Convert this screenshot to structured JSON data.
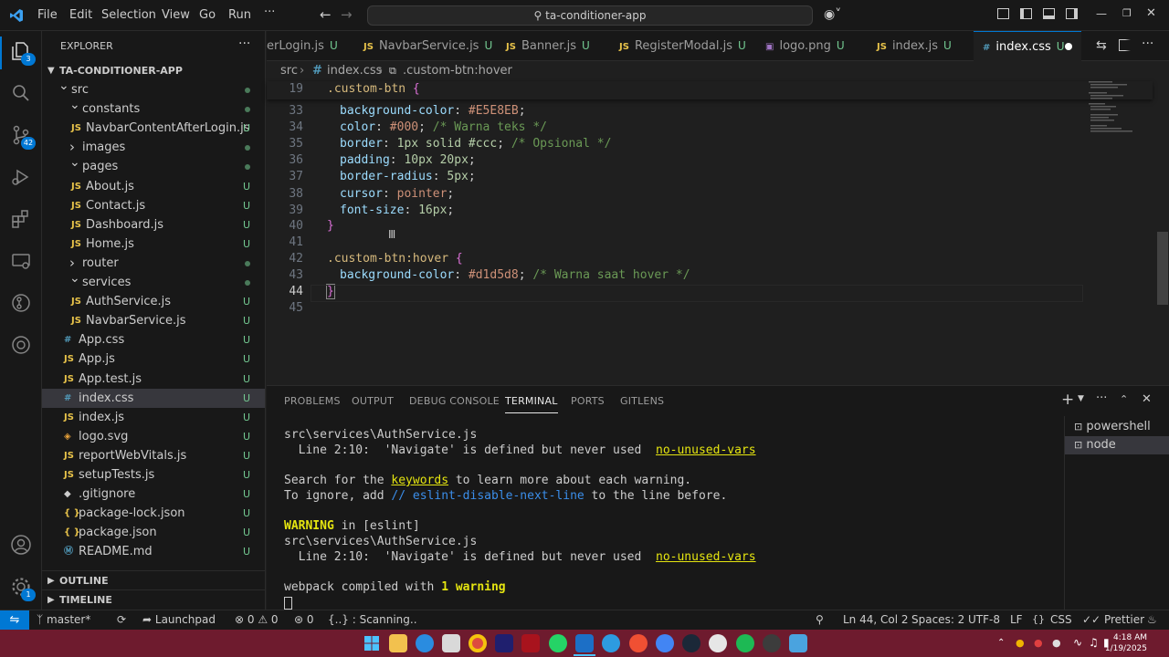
{
  "menu": [
    "File",
    "Edit",
    "Selection",
    "View",
    "Go",
    "Run",
    "···"
  ],
  "command_center": "ta-conditioner-app",
  "activity_badges": {
    "source_control": "42",
    "extensions": "3",
    "settings": "1"
  },
  "sidebar": {
    "title": "EXPLORER",
    "root": "TA-CONDITIONER-APP",
    "items": [
      {
        "label": "src",
        "kind": "folder-open",
        "status": "dot"
      },
      {
        "label": "constants",
        "kind": "folder-open",
        "status": "dot"
      },
      {
        "label": "NavbarContentAfterLogin.js",
        "kind": "js",
        "status": "U"
      },
      {
        "label": "images",
        "kind": "folder-closed",
        "status": "dot"
      },
      {
        "label": "pages",
        "kind": "folder-open",
        "status": "dot"
      },
      {
        "label": "About.js",
        "kind": "js",
        "status": "U"
      },
      {
        "label": "Contact.js",
        "kind": "js",
        "status": "U"
      },
      {
        "label": "Dashboard.js",
        "kind": "js",
        "status": "U"
      },
      {
        "label": "Home.js",
        "kind": "js",
        "status": "U"
      },
      {
        "label": "router",
        "kind": "folder-closed",
        "status": "dot"
      },
      {
        "label": "services",
        "kind": "folder-open",
        "status": "dot"
      },
      {
        "label": "AuthService.js",
        "kind": "js",
        "status": "U"
      },
      {
        "label": "NavbarService.js",
        "kind": "js",
        "status": "U"
      },
      {
        "label": "App.css",
        "kind": "css",
        "status": "U"
      },
      {
        "label": "App.js",
        "kind": "js",
        "status": "U"
      },
      {
        "label": "App.test.js",
        "kind": "js",
        "status": "U"
      },
      {
        "label": "index.css",
        "kind": "css",
        "status": "U"
      },
      {
        "label": "index.js",
        "kind": "js",
        "status": "U"
      },
      {
        "label": "logo.svg",
        "kind": "svg",
        "status": "U"
      },
      {
        "label": "reportWebVitals.js",
        "kind": "js",
        "status": "U"
      },
      {
        "label": "setupTests.js",
        "kind": "js",
        "status": "U"
      },
      {
        "label": ".gitignore",
        "kind": "git",
        "status": "U"
      },
      {
        "label": "package-lock.json",
        "kind": "json",
        "status": "U"
      },
      {
        "label": "package.json",
        "kind": "json",
        "status": "U"
      },
      {
        "label": "README.md",
        "kind": "md",
        "status": "U"
      }
    ],
    "outline": "OUTLINE",
    "timeline": "TIMELINE"
  },
  "tabs": [
    {
      "label": "erLogin.js",
      "status": "U",
      "icon": "JS"
    },
    {
      "label": "NavbarService.js",
      "status": "U",
      "icon": "JS"
    },
    {
      "label": "Banner.js",
      "status": "U",
      "icon": "JS"
    },
    {
      "label": "RegisterModal.js",
      "status": "U",
      "icon": "JS"
    },
    {
      "label": "logo.png",
      "status": "U",
      "icon": "img"
    },
    {
      "label": "index.js",
      "status": "U",
      "icon": "JS"
    },
    {
      "label": "index.css",
      "status": "U",
      "icon": "#"
    }
  ],
  "breadcrumb": {
    "folder": "src",
    "file": "index.css",
    "symbol": ".custom-btn:hover"
  },
  "editor": {
    "sticky": {
      "ln": "19",
      "selector": ".custom-btn",
      "brace": "{"
    },
    "lines": [
      {
        "ln": "33",
        "prop": "background-color",
        "value": "#E5E8EB",
        "comment": ""
      },
      {
        "ln": "34",
        "prop": "color",
        "value": "#000",
        "comment": "/* Warna teks */"
      },
      {
        "ln": "35",
        "prop": "border",
        "value": "1px solid #ccc",
        "comment": "/* Opsional */"
      },
      {
        "ln": "36",
        "prop": "padding",
        "value": "10px 20px",
        "comment": ""
      },
      {
        "ln": "37",
        "prop": "border-radius",
        "value": "5px",
        "comment": ""
      },
      {
        "ln": "38",
        "prop": "cursor",
        "value": "pointer",
        "comment": ""
      },
      {
        "ln": "39",
        "prop": "font-size",
        "value": "16px",
        "comment": ""
      }
    ],
    "l40": {
      "ln": "40",
      "text": "}"
    },
    "l41": {
      "ln": "41"
    },
    "l42": {
      "ln": "42",
      "selector": ".custom-btn:hover",
      "brace": "{"
    },
    "l43": {
      "ln": "43",
      "prop": "background-color",
      "value": "#d1d5d8",
      "comment": "/* Warna saat hover */"
    },
    "l44": {
      "ln": "44",
      "text": "}"
    },
    "l45": {
      "ln": "45"
    }
  },
  "panel": {
    "tabs": [
      "PROBLEMS",
      "OUTPUT",
      "DEBUG CONSOLE",
      "TERMINAL",
      "PORTS",
      "GITLENS"
    ],
    "active_tab": "TERMINAL",
    "terminals": [
      "powershell",
      "node"
    ],
    "output": {
      "l1": "src\\services\\AuthService.js",
      "l2a": "  Line 2:10:  'Navigate' is defined but never used  ",
      "l2b": "no-unused-vars",
      "l3a": "Search for the ",
      "l3b": "keywords",
      "l3c": " to learn more about each warning.",
      "l4a": "To ignore, add ",
      "l4b": "// eslint-disable-next-line",
      "l4c": " to the line before.",
      "l5a": "WARNING",
      "l5b": " in [eslint]",
      "l6": "src\\services\\AuthService.js",
      "l7a": "  Line 2:10:  'Navigate' is defined but never used  ",
      "l7b": "no-unused-vars",
      "l8a": "webpack compiled with ",
      "l8b": "1 warning"
    }
  },
  "statusbar": {
    "branch": "master*",
    "launchpad": "Launchpad",
    "problems": "⊗ 0 ⚠ 0",
    "ports": "0",
    "scanning": "{..} : Scanning..",
    "position": "Ln 44, Col 2",
    "spaces": "Spaces: 2",
    "encoding": "UTF-8",
    "eol": "LF",
    "language": "CSS",
    "formatter": "Prettier"
  },
  "taskbar": {
    "time": "4:18 AM",
    "date": "1/19/2025"
  },
  "colors": {
    "accent": "#0078d4",
    "taskbar": "#6e1b2e",
    "untracked": "#73c991"
  }
}
